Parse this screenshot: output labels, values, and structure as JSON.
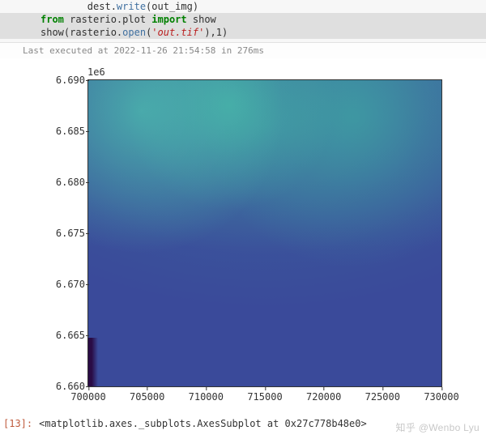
{
  "code": {
    "line1_pre": "        dest.",
    "line1_method": "write",
    "line1_post": "(out_img)",
    "line2_kw1": "from",
    "line2_mod": " rasterio.plot ",
    "line2_kw2": "import",
    "line2_post": " show",
    "line3_pre": "show(rasterio.",
    "line3_method": "open",
    "line3_paren": "(",
    "line3_str": "'out.tif'",
    "line3_post": "),1)"
  },
  "exec_info": "Last executed at 2022-11-26 21:54:58 in 276ms",
  "chart_data": {
    "type": "heatmap",
    "exponent_label": "1e6",
    "xlim": [
      700000,
      730000
    ],
    "ylim": [
      6.66,
      6.69
    ],
    "xticks": [
      "700000",
      "705000",
      "710000",
      "715000",
      "720000",
      "725000",
      "730000"
    ],
    "yticks": [
      "6.690",
      "6.685",
      "6.680",
      "6.675",
      "6.670",
      "6.665",
      "6.660"
    ],
    "description": "Raster image displayed via rasterio.show, band 1; predominantly dark blue (viridis) with mottled teal/cyan texture in upper half and a small dark-purple sliver at bottom-left edge."
  },
  "output": {
    "prompt": "[13]:",
    "text": "<matplotlib.axes._subplots.AxesSubplot at 0x27c778b48e0>"
  },
  "watermark": "知乎 @Wenbo Lyu"
}
